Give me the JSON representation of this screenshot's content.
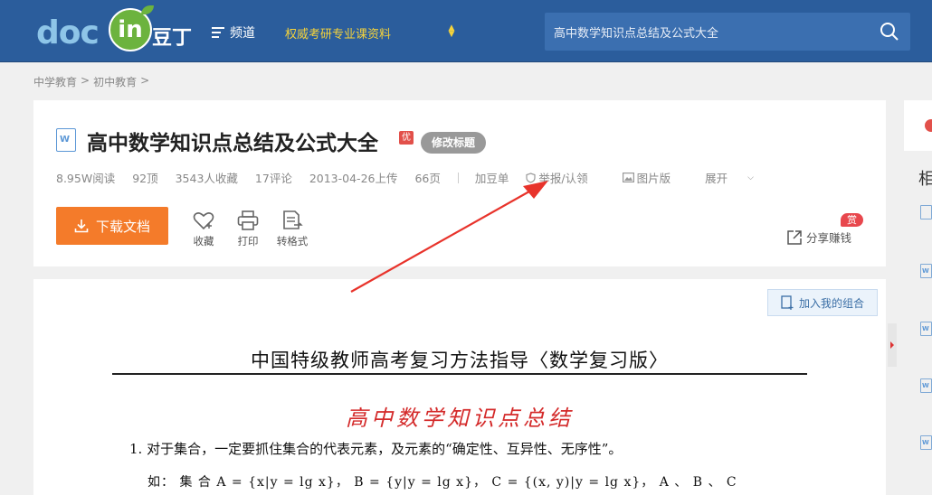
{
  "header": {
    "logo_text": "doc",
    "logo_badge": "in",
    "logo_cn": "豆丁",
    "channel_label": "频道",
    "promo_label": "权威考研专业课资料",
    "search_value": "高中数学知识点总结及公式大全",
    "brand_color": "#2b5d9c"
  },
  "breadcrumb": {
    "items": [
      "中学教育",
      "初中教育"
    ],
    "sep": ">"
  },
  "document": {
    "title": "高中数学知识点总结及公式大全",
    "quality_badge": "优",
    "edit_title_label": "修改标题",
    "meta": {
      "reads": "8.95W阅读",
      "likes": "92顶",
      "favorites": "3543人收藏",
      "comments": "17评论",
      "uploaded": "2013-04-26上传",
      "pages": "66页",
      "add_douban": "加豆单",
      "report": "举报/认领",
      "image_version": "图片版",
      "expand": "展开"
    },
    "actions": {
      "download_label": "下载文档",
      "favorite_label": "收藏",
      "print_label": "打印",
      "convert_label": "转格式",
      "share_label": "分享赚钱",
      "reward_badge": "赏"
    },
    "accent_color": "#f47b2a"
  },
  "preview": {
    "add_combo_label": "加入我的组合",
    "heading": "中国特级教师高考复习方法指导〈数学复习版〉",
    "red_title": "高中数学知识点总结",
    "line1": "1. 对于集合，一定要抓住集合的代表元素，及元素的“确定性、互异性、无序性”。",
    "line2": "如：  集 合 A = {x|y = lg x}，  B = {y|y = lg x}，  C = {(x, y)|y = lg x}，  A 、 B 、 C"
  },
  "sidebar": {
    "heading_partial": "相"
  }
}
